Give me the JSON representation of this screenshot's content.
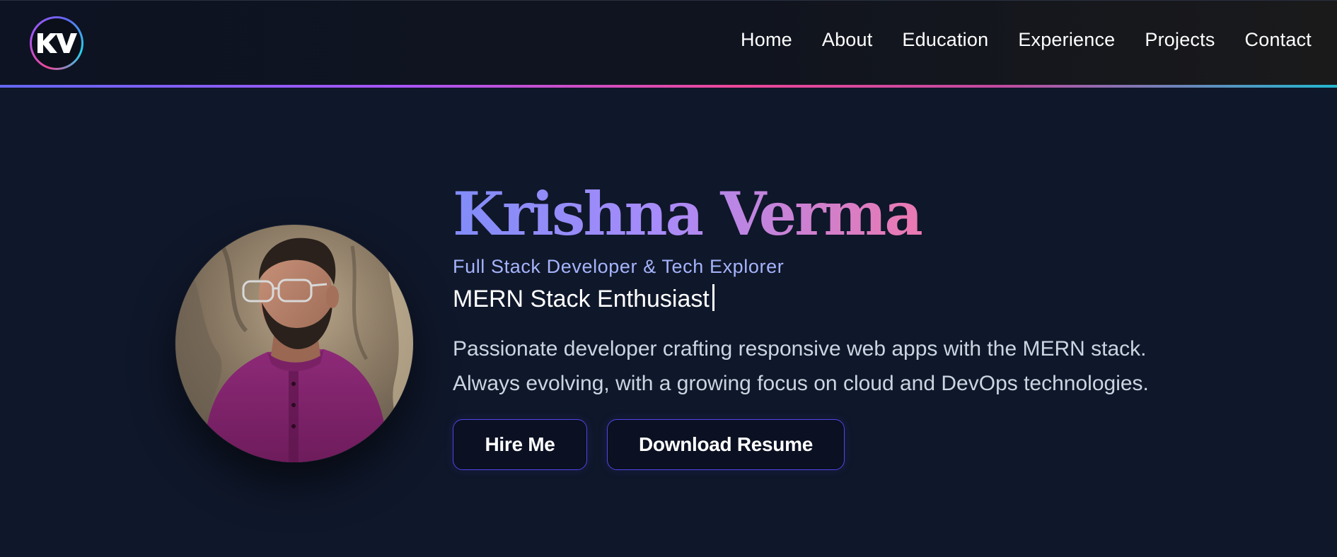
{
  "nav": {
    "logo_text": "KV",
    "links": [
      {
        "label": "Home"
      },
      {
        "label": "About"
      },
      {
        "label": "Education"
      },
      {
        "label": "Experience"
      },
      {
        "label": "Projects"
      },
      {
        "label": "Contact"
      }
    ]
  },
  "hero": {
    "name": "Krishna Verma",
    "subtitle": "Full Stack Developer & Tech Explorer",
    "typed_text": "MERN Stack Enthusiast",
    "description": "Passionate developer crafting responsive web apps with the MERN stack. Always evolving, with a growing focus on cloud and DevOps technologies.",
    "buttons": {
      "hire": "Hire Me",
      "resume": "Download Resume"
    }
  },
  "colors": {
    "background": "#0f172a",
    "accent_indigo": "#6366f1",
    "accent_pink": "#ec4899",
    "accent_cyan": "#22b8cf",
    "subtitle": "#a5b4fc",
    "button_border": "#4f46e5"
  }
}
